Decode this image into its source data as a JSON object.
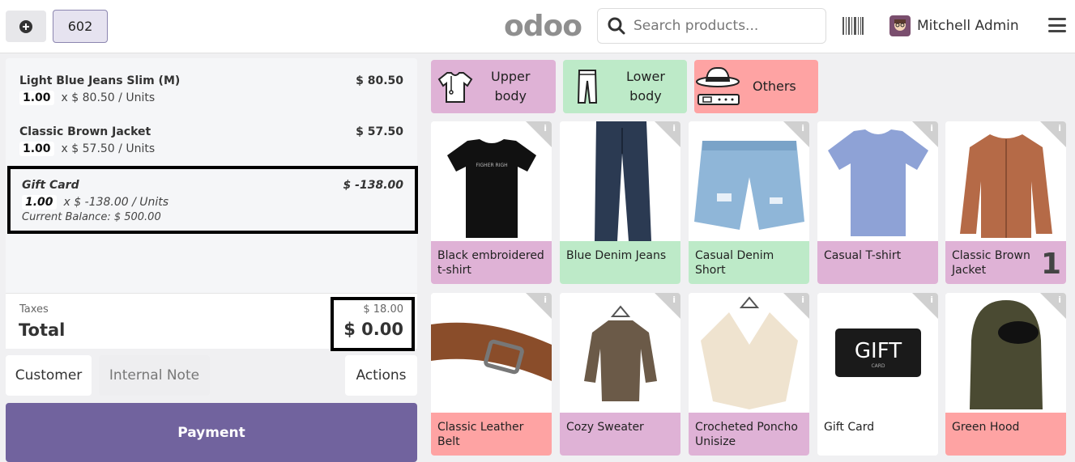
{
  "header": {
    "order_number": "602",
    "logo_text": "odoo",
    "search_placeholder": "Search products...",
    "user_name": "Mitchell Admin"
  },
  "order": {
    "lines": [
      {
        "name": "Light Blue Jeans Slim (M)",
        "price": "$ 80.50",
        "qty": "1.00",
        "unit_text": "x $ 80.50 / Units"
      },
      {
        "name": "Classic Brown Jacket",
        "price": "$ 57.50",
        "qty": "1.00",
        "unit_text": "x $ 57.50 / Units"
      },
      {
        "name": "Gift Card",
        "price": "$ -138.00",
        "qty": "1.00",
        "unit_text": "x $ -138.00 / Units",
        "balance": "Current Balance: $ 500.00"
      }
    ],
    "taxes_label": "Taxes",
    "taxes_value": "$ 18.00",
    "total_label": "Total",
    "total_value": "$ 0.00"
  },
  "controls": {
    "customer": "Customer",
    "internal_note": "Internal Note",
    "actions": "Actions",
    "payment": "Payment"
  },
  "categories": [
    {
      "label_1": "Upper",
      "label_2": "body",
      "icon": "tshirt-icon",
      "color": "#dfb2d6"
    },
    {
      "label_1": "Lower",
      "label_2": "body",
      "icon": "pants-icon",
      "color": "#bdeac8"
    },
    {
      "label_1": "Others",
      "icon": "hat-belt-icon",
      "color": "#fea3a3"
    }
  ],
  "products": [
    {
      "name": "Black embroidered t-shirt",
      "color": "#dfb2d6"
    },
    {
      "name": "Blue Denim Jeans",
      "color": "#bdeac8"
    },
    {
      "name": "Casual Denim Short",
      "color": "#bdeac8"
    },
    {
      "name": "Casual T-shirt",
      "color": "#dfb2d6"
    },
    {
      "name": "Classic Brown Jacket",
      "color": "#dfb2d6",
      "count": "1"
    },
    {
      "name": "Classic Leather Belt",
      "color": "#fea3a3"
    },
    {
      "name": "Cozy Sweater",
      "color": "#dfb2d6"
    },
    {
      "name": "Crocheted Poncho Unisize",
      "color": "#dfb2d6"
    },
    {
      "name": "Gift Card",
      "color": "#ffffff",
      "image_text": "GIFT",
      "image_subtext": "CARD"
    },
    {
      "name": "Green Hood",
      "color": "#fea3a3"
    }
  ],
  "info_glyph": "i"
}
